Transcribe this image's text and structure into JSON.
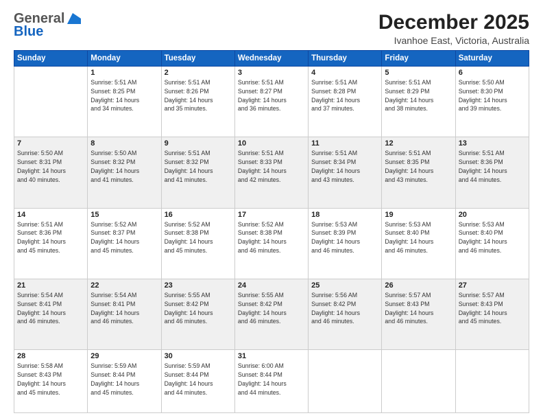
{
  "logo": {
    "general": "General",
    "blue": "Blue"
  },
  "header": {
    "month": "December 2025",
    "location": "Ivanhoe East, Victoria, Australia"
  },
  "days": [
    "Sunday",
    "Monday",
    "Tuesday",
    "Wednesday",
    "Thursday",
    "Friday",
    "Saturday"
  ],
  "weeks": [
    [
      {
        "day": "",
        "info": ""
      },
      {
        "day": "1",
        "info": "Sunrise: 5:51 AM\nSunset: 8:25 PM\nDaylight: 14 hours\nand 34 minutes."
      },
      {
        "day": "2",
        "info": "Sunrise: 5:51 AM\nSunset: 8:26 PM\nDaylight: 14 hours\nand 35 minutes."
      },
      {
        "day": "3",
        "info": "Sunrise: 5:51 AM\nSunset: 8:27 PM\nDaylight: 14 hours\nand 36 minutes."
      },
      {
        "day": "4",
        "info": "Sunrise: 5:51 AM\nSunset: 8:28 PM\nDaylight: 14 hours\nand 37 minutes."
      },
      {
        "day": "5",
        "info": "Sunrise: 5:51 AM\nSunset: 8:29 PM\nDaylight: 14 hours\nand 38 minutes."
      },
      {
        "day": "6",
        "info": "Sunrise: 5:50 AM\nSunset: 8:30 PM\nDaylight: 14 hours\nand 39 minutes."
      }
    ],
    [
      {
        "day": "7",
        "info": "Sunrise: 5:50 AM\nSunset: 8:31 PM\nDaylight: 14 hours\nand 40 minutes."
      },
      {
        "day": "8",
        "info": "Sunrise: 5:50 AM\nSunset: 8:32 PM\nDaylight: 14 hours\nand 41 minutes."
      },
      {
        "day": "9",
        "info": "Sunrise: 5:51 AM\nSunset: 8:32 PM\nDaylight: 14 hours\nand 41 minutes."
      },
      {
        "day": "10",
        "info": "Sunrise: 5:51 AM\nSunset: 8:33 PM\nDaylight: 14 hours\nand 42 minutes."
      },
      {
        "day": "11",
        "info": "Sunrise: 5:51 AM\nSunset: 8:34 PM\nDaylight: 14 hours\nand 43 minutes."
      },
      {
        "day": "12",
        "info": "Sunrise: 5:51 AM\nSunset: 8:35 PM\nDaylight: 14 hours\nand 43 minutes."
      },
      {
        "day": "13",
        "info": "Sunrise: 5:51 AM\nSunset: 8:36 PM\nDaylight: 14 hours\nand 44 minutes."
      }
    ],
    [
      {
        "day": "14",
        "info": "Sunrise: 5:51 AM\nSunset: 8:36 PM\nDaylight: 14 hours\nand 45 minutes."
      },
      {
        "day": "15",
        "info": "Sunrise: 5:52 AM\nSunset: 8:37 PM\nDaylight: 14 hours\nand 45 minutes."
      },
      {
        "day": "16",
        "info": "Sunrise: 5:52 AM\nSunset: 8:38 PM\nDaylight: 14 hours\nand 45 minutes."
      },
      {
        "day": "17",
        "info": "Sunrise: 5:52 AM\nSunset: 8:38 PM\nDaylight: 14 hours\nand 46 minutes."
      },
      {
        "day": "18",
        "info": "Sunrise: 5:53 AM\nSunset: 8:39 PM\nDaylight: 14 hours\nand 46 minutes."
      },
      {
        "day": "19",
        "info": "Sunrise: 5:53 AM\nSunset: 8:40 PM\nDaylight: 14 hours\nand 46 minutes."
      },
      {
        "day": "20",
        "info": "Sunrise: 5:53 AM\nSunset: 8:40 PM\nDaylight: 14 hours\nand 46 minutes."
      }
    ],
    [
      {
        "day": "21",
        "info": "Sunrise: 5:54 AM\nSunset: 8:41 PM\nDaylight: 14 hours\nand 46 minutes."
      },
      {
        "day": "22",
        "info": "Sunrise: 5:54 AM\nSunset: 8:41 PM\nDaylight: 14 hours\nand 46 minutes."
      },
      {
        "day": "23",
        "info": "Sunrise: 5:55 AM\nSunset: 8:42 PM\nDaylight: 14 hours\nand 46 minutes."
      },
      {
        "day": "24",
        "info": "Sunrise: 5:55 AM\nSunset: 8:42 PM\nDaylight: 14 hours\nand 46 minutes."
      },
      {
        "day": "25",
        "info": "Sunrise: 5:56 AM\nSunset: 8:42 PM\nDaylight: 14 hours\nand 46 minutes."
      },
      {
        "day": "26",
        "info": "Sunrise: 5:57 AM\nSunset: 8:43 PM\nDaylight: 14 hours\nand 46 minutes."
      },
      {
        "day": "27",
        "info": "Sunrise: 5:57 AM\nSunset: 8:43 PM\nDaylight: 14 hours\nand 45 minutes."
      }
    ],
    [
      {
        "day": "28",
        "info": "Sunrise: 5:58 AM\nSunset: 8:43 PM\nDaylight: 14 hours\nand 45 minutes."
      },
      {
        "day": "29",
        "info": "Sunrise: 5:59 AM\nSunset: 8:44 PM\nDaylight: 14 hours\nand 45 minutes."
      },
      {
        "day": "30",
        "info": "Sunrise: 5:59 AM\nSunset: 8:44 PM\nDaylight: 14 hours\nand 44 minutes."
      },
      {
        "day": "31",
        "info": "Sunrise: 6:00 AM\nSunset: 8:44 PM\nDaylight: 14 hours\nand 44 minutes."
      },
      {
        "day": "",
        "info": ""
      },
      {
        "day": "",
        "info": ""
      },
      {
        "day": "",
        "info": ""
      }
    ]
  ]
}
